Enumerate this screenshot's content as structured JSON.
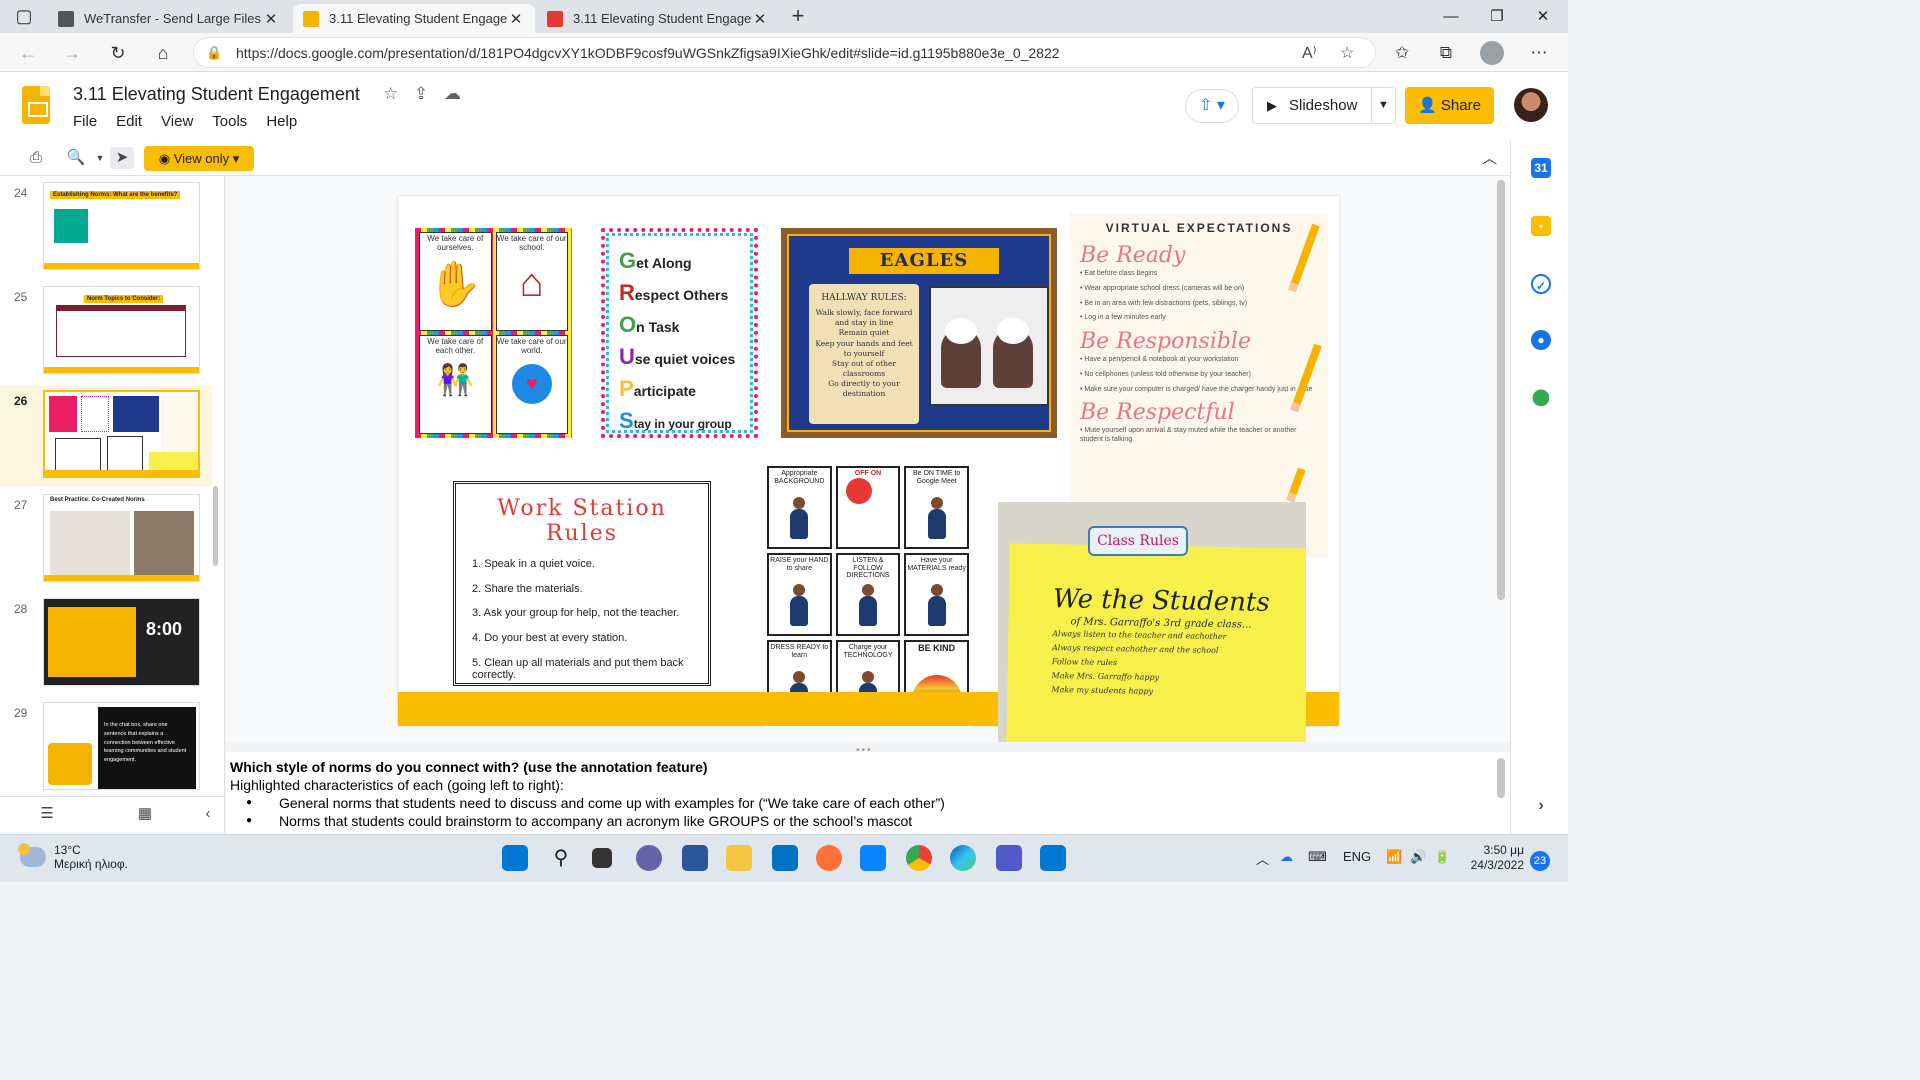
{
  "browser": {
    "tabs": [
      {
        "title": "WeTransfer - Send Large Files &",
        "active": false
      },
      {
        "title": "3.11 Elevating Student Engagem",
        "active": true
      },
      {
        "title": "3.11 Elevating Student Engagem",
        "active": false
      }
    ],
    "url": "https://docs.google.com/presentation/d/181PO4dgcvXY1kODBF9cosf9uWGSnkZfigsa9IXieGhk/edit#slide=id.g1195b880e3e_0_2822"
  },
  "doc": {
    "title": "3.11 Elevating Student Engagement",
    "menu": [
      "File",
      "Edit",
      "View",
      "Tools",
      "Help"
    ],
    "slideshow_label": "Slideshow",
    "share_label": "Share",
    "view_only_label": "View only"
  },
  "filmstrip": {
    "slides": [
      {
        "num": "24",
        "title": "Establishing Norms: What are the benefits?"
      },
      {
        "num": "25",
        "title": "Norm Topics to Consider:"
      },
      {
        "num": "26",
        "title": ""
      },
      {
        "num": "27",
        "title": "Best Practice: Co-Created Norms"
      },
      {
        "num": "28",
        "title": "8:00"
      },
      {
        "num": "29",
        "title": "In the chat box, share one sentence that explains a connection between effective learning communities and student engagement."
      }
    ],
    "active": "26"
  },
  "slide": {
    "cards": [
      "We take care of ourselves.",
      "We take care of our school.",
      "We take care of each other.",
      "We take care of our world."
    ],
    "groups": [
      {
        "letter": "G",
        "rest": "et Along"
      },
      {
        "letter": "R",
        "rest": "espect Others"
      },
      {
        "letter": "O",
        "rest": "n Task"
      },
      {
        "letter": "U",
        "rest": "se quiet voices"
      },
      {
        "letter": "P",
        "rest": "articipate"
      },
      {
        "letter": "S",
        "rest": "tay in your group"
      }
    ],
    "eagles": {
      "banner": "EAGLES",
      "rules_heading": "HALLWAY RULES:",
      "rules": [
        "Walk slowly, face forward and stay in line",
        "Remain quiet",
        "Keep your hands and feet to yourself",
        "Stay out of other classrooms",
        "Go directly to your destination"
      ]
    },
    "virtual": {
      "heading": "VIRTUAL EXPECTATIONS",
      "sections": [
        {
          "title": "Be Ready",
          "items": [
            "Eat before class begins",
            "Wear appropriate school dress (cameras will be on)",
            "Be in an area with few distractions (pets, siblings, tv)",
            "Log in a few minutes early"
          ]
        },
        {
          "title": "Be Responsible",
          "items": [
            "Have a pen/pencil & notebook at your workstation",
            "No cellphones (unless told otherwise by your teacher)",
            "Make sure your computer is charged/ have the charger handy just in case"
          ]
        },
        {
          "title": "Be Respectful",
          "items": [
            "Mute yourself upon arrival & stay muted while the teacher or another student is talking"
          ]
        }
      ]
    },
    "workstation": {
      "heading": "Work Station Rules",
      "rules": [
        "1. Speak in a quiet voice.",
        "2. Share the materials.",
        "3. Ask your group for help, not the teacher.",
        "4. Do your best at every station.",
        "5. Clean up all materials and put them back correctly."
      ]
    },
    "grid": [
      "Appropriate BACKGROUND",
      "OFF ON",
      "Be ON TIME to Google Meet",
      "RAISE your HAND to share",
      "LISTEN & FOLLOW DIRECTIONS",
      "Have your MATERIALS ready",
      "DRESS READY to learn",
      "Charge your TECHNOLOGY",
      "BE KIND"
    ],
    "photo": {
      "header": "Class Rules",
      "title": "We the Students",
      "subtitle": "of Mrs. Garraffo's 3rd grade class...",
      "lines": [
        "Always listen to the teacher and eachother",
        "Always respect eachother and the school",
        "Follow the rules",
        "Make Mrs. Garraffo happy",
        "Make my students happy"
      ]
    }
  },
  "notes": {
    "question": "Which style of norms do you connect with? (use the annotation feature)",
    "intro": "Highlighted characteristics of each (going left to right):",
    "bullets": [
      "General norms that students need to discuss and come up with examples for (“We take care of each other”)",
      "Norms that students could brainstorm to accompany an acronym like GROUPS or the school’s mascot"
    ]
  },
  "taskbar": {
    "temp": "13°C",
    "weather": "Μερική ηλιοφ.",
    "lang": "ENG",
    "time": "3:50 μμ",
    "date": "24/3/2022",
    "notifications": "23"
  }
}
